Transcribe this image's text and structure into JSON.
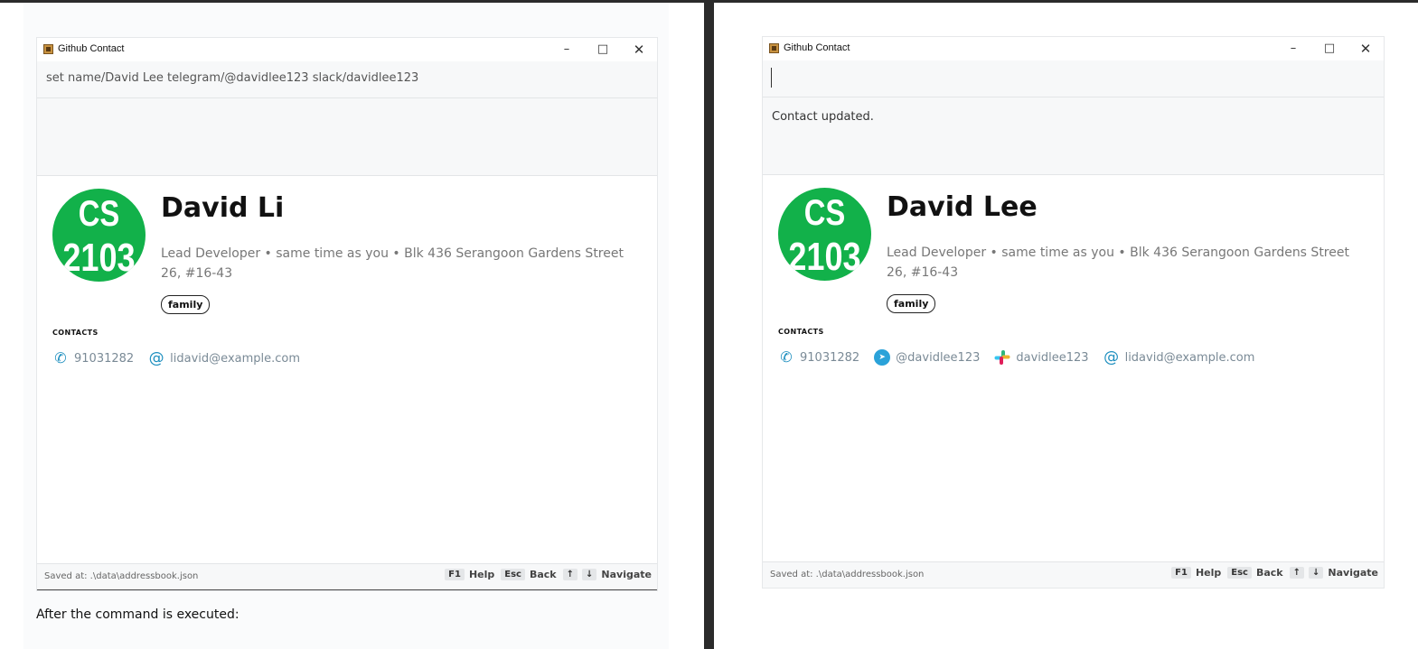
{
  "left": {
    "window_title": "Github Contact",
    "window_controls": {
      "minimize": "–",
      "maximize": "□",
      "close": "✕"
    },
    "command_text": "set name/David Lee telegram/@davidlee123 slack/davidlee123",
    "result_text": "",
    "avatar_lines": [
      "CS",
      "2103"
    ],
    "name": "David Li",
    "description": "Lead Developer • same time as you • Blk 436 Serangoon Gardens Street 26, #16-43",
    "tag": "family",
    "contacts_header": "CONTACTS",
    "contacts": [
      {
        "icon": "phone-icon",
        "text": "91031282"
      },
      {
        "icon": "at-icon",
        "text": "lidavid@example.com"
      }
    ],
    "saved_at": "Saved at: .\\data\\addressbook.json",
    "shortcuts": [
      {
        "key": "F1",
        "label": "Help"
      },
      {
        "key": "Esc",
        "label": "Back"
      },
      {
        "key": "↑",
        "label": ""
      },
      {
        "key": "↓",
        "label": "Navigate"
      }
    ],
    "caption": "After the command is executed:"
  },
  "right": {
    "window_title": "Github Contact",
    "window_controls": {
      "minimize": "–",
      "maximize": "□",
      "close": "✕"
    },
    "command_text": "",
    "result_text": "Contact updated.",
    "avatar_lines": [
      "CS",
      "2103"
    ],
    "name": "David Lee",
    "description": "Lead Developer • same time as you • Blk 436 Serangoon Gardens Street 26, #16-43",
    "tag": "family",
    "contacts_header": "CONTACTS",
    "contacts": [
      {
        "icon": "phone-icon",
        "text": "91031282"
      },
      {
        "icon": "telegram-icon",
        "text": "@davidlee123"
      },
      {
        "icon": "slack-icon",
        "text": "davidlee123"
      },
      {
        "icon": "at-icon",
        "text": "lidavid@example.com"
      }
    ],
    "saved_at": "Saved at: .\\data\\addressbook.json",
    "shortcuts": [
      {
        "key": "F1",
        "label": "Help"
      },
      {
        "key": "Esc",
        "label": "Back"
      },
      {
        "key": "↑",
        "label": ""
      },
      {
        "key": "↓",
        "label": "Navigate"
      }
    ]
  },
  "colors": {
    "avatar": "#12b14a",
    "icon_accent": "#1e8fbf",
    "telegram": "#2aa2d9",
    "divider": "#2b2b2b"
  }
}
